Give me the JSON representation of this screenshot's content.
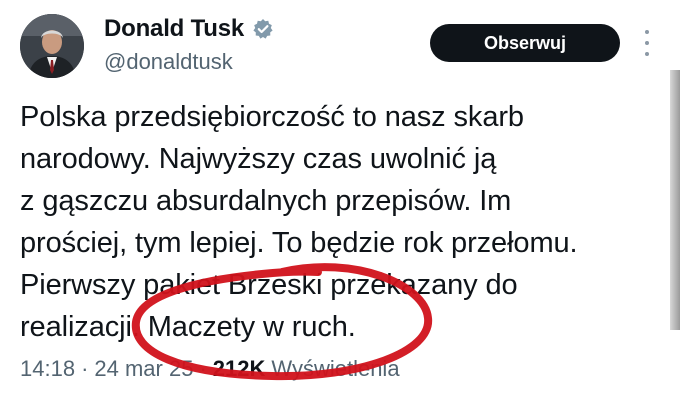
{
  "author": {
    "display_name": "Donald Tusk",
    "handle": "@donaldtusk",
    "verified_icon": "verified-badge-icon",
    "avatar_icon": "profile-photo"
  },
  "actions": {
    "follow_label": "Obserwuj",
    "more_icon": "more-vertical-icon"
  },
  "tweet": {
    "lines": [
      "Polska przedsiębiorczość to nasz skarb",
      "narodowy. Najwyższy czas uwolnić ją",
      "z gąszczu absurdalnych przepisów. Im",
      "prościej, tym lepiej. To będzie rok przełomu.",
      "Pierwszy pakiet Brzeski przekazany do",
      "realizacji. Maczety w ruch."
    ]
  },
  "meta": {
    "time": "14:18",
    "separator": "·",
    "date": "24 mar 25",
    "views_count": "212K",
    "views_label": "Wyświetlenia"
  },
  "annotation": {
    "color": "#d1121b"
  }
}
